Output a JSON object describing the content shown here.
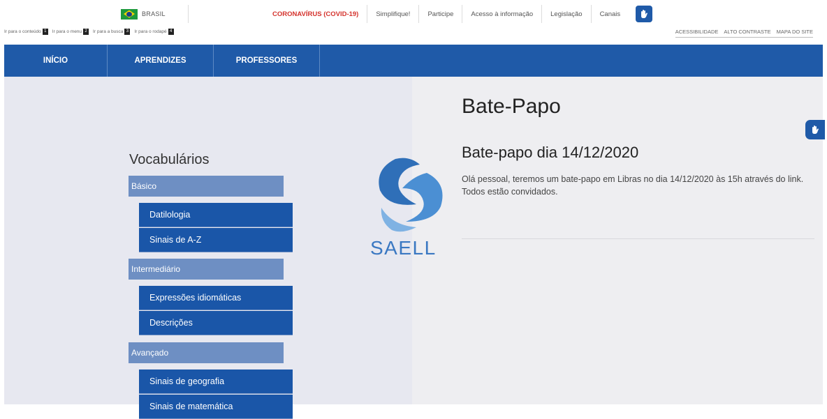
{
  "gov_bar": {
    "brand": "BRASIL",
    "links": [
      "CORONAVÍRUS (COVID-19)",
      "Simplifique!",
      "Participe",
      "Acesso à informação",
      "Legislação",
      "Canais"
    ]
  },
  "access_bar": {
    "skip_links": [
      {
        "label": "Ir para o conteúdo",
        "num": "1"
      },
      {
        "label": "Ir para o menu",
        "num": "2"
      },
      {
        "label": "Ir para a busca",
        "num": "3"
      },
      {
        "label": "Ir para o rodapé",
        "num": "4"
      }
    ],
    "right_links": [
      "ACESSIBILIDADE",
      "ALTO CONTRASTE",
      "MAPA DO SITE"
    ]
  },
  "nav": {
    "items": [
      "INÍCIO",
      "APRENDIZES",
      "PROFESSORES"
    ]
  },
  "sidebar": {
    "title": "Vocabulários",
    "levels": [
      {
        "label": "Básico",
        "items": [
          "Datilologia",
          "Sinais de A-Z"
        ]
      },
      {
        "label": "Intermediário",
        "items": [
          "Expressões idiomáticas",
          "Descrições"
        ]
      },
      {
        "label": "Avançado",
        "items": [
          "Sinais de geografia",
          "Sinais de matemática"
        ]
      }
    ]
  },
  "logo": {
    "text": "SAELL"
  },
  "main": {
    "page_title": "Bate-Papo",
    "post_title": "Bate-papo dia 14/12/2020",
    "post_body": "Olá pessoal, teremos um bate-papo em Libras no dia 14/12/2020 às 15h através do link. Todos estão convidados."
  },
  "colors": {
    "nav_blue": "#1f5aa8",
    "level_blue": "#6e8fc3",
    "covid_red": "#d4322c"
  }
}
